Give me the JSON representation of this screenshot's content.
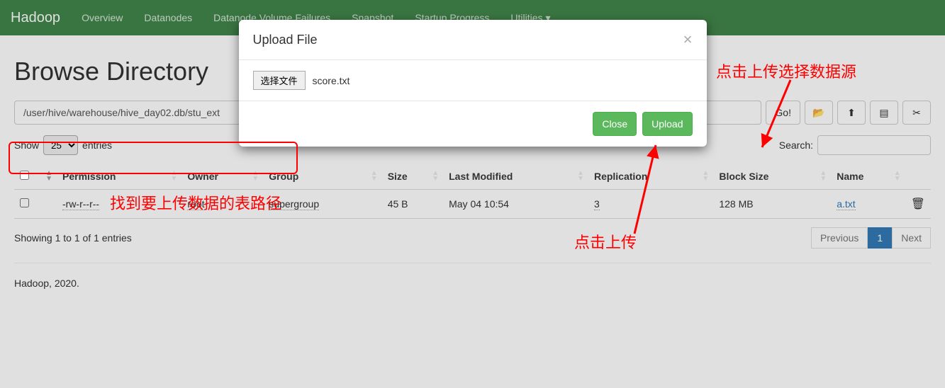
{
  "navbar": {
    "brand": "Hadoop",
    "items": [
      "Overview",
      "Datanodes",
      "Datanode Volume Failures",
      "Snapshot",
      "Startup Progress",
      "Utilities"
    ]
  },
  "page": {
    "title": "Browse Directory",
    "path": "/user/hive/warehouse/hive_day02.db/stu_ext",
    "go_label": "Go!"
  },
  "controls": {
    "show_label": "Show",
    "entries_label": "entries",
    "entries_value": "25",
    "search_label": "Search:"
  },
  "table": {
    "headers": [
      "",
      "",
      "Permission",
      "Owner",
      "Group",
      "Size",
      "Last Modified",
      "Replication",
      "Block Size",
      "Name",
      ""
    ],
    "rows": [
      {
        "permission": "-rw-r--r--",
        "owner": "root",
        "group": "supergroup",
        "size": "45 B",
        "modified": "May 04 10:54",
        "replication": "3",
        "block_size": "128 MB",
        "name": "a.txt"
      }
    ]
  },
  "info": {
    "showing": "Showing 1 to 1 of 1 entries"
  },
  "pagination": {
    "previous": "Previous",
    "next": "Next",
    "pages": [
      "1"
    ]
  },
  "footer": "Hadoop, 2020.",
  "modal": {
    "title": "Upload File",
    "choose_label": "选择文件",
    "filename": "score.txt",
    "close_label": "Close",
    "upload_label": "Upload"
  },
  "annotations": {
    "top_right": "点击上传选择数据源",
    "mid": "点击上传",
    "path": "找到要上传数据的表路径"
  }
}
